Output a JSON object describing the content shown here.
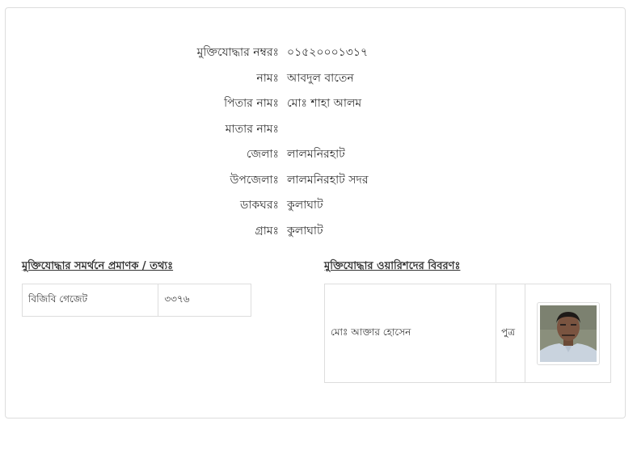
{
  "info": [
    {
      "label": "মুক্তিযোদ্ধার নম্বরঃ",
      "value": "০১৫২০০০১৩১৭"
    },
    {
      "label": "নামঃ",
      "value": "আবদুল বাতেন"
    },
    {
      "label": "পিতার নামঃ",
      "value": "মোঃ শাহা আলম"
    },
    {
      "label": "মাতার নামঃ",
      "value": ""
    },
    {
      "label": "জেলাঃ",
      "value": "লালমনিরহাট"
    },
    {
      "label": "উপজেলাঃ",
      "value": "লালমনিরহাট সদর"
    },
    {
      "label": "ডাকঘরঃ",
      "value": "কুলাঘাট"
    },
    {
      "label": "গ্রামঃ",
      "value": "কুলাঘাট"
    }
  ],
  "evidence": {
    "title": "মুক্তিযোদ্ধার সমর্থনে প্রমাণক / তথ্যঃ",
    "rows": [
      {
        "source": "বিজিবি গেজেট",
        "number": "৩৩৭৬"
      }
    ]
  },
  "heirs": {
    "title": "মুক্তিযোদ্ধার ওয়ারিশদের বিবরণঃ",
    "rows": [
      {
        "name": "মোঃ আক্তার হোসেন",
        "relation": "পুত্র"
      }
    ]
  }
}
